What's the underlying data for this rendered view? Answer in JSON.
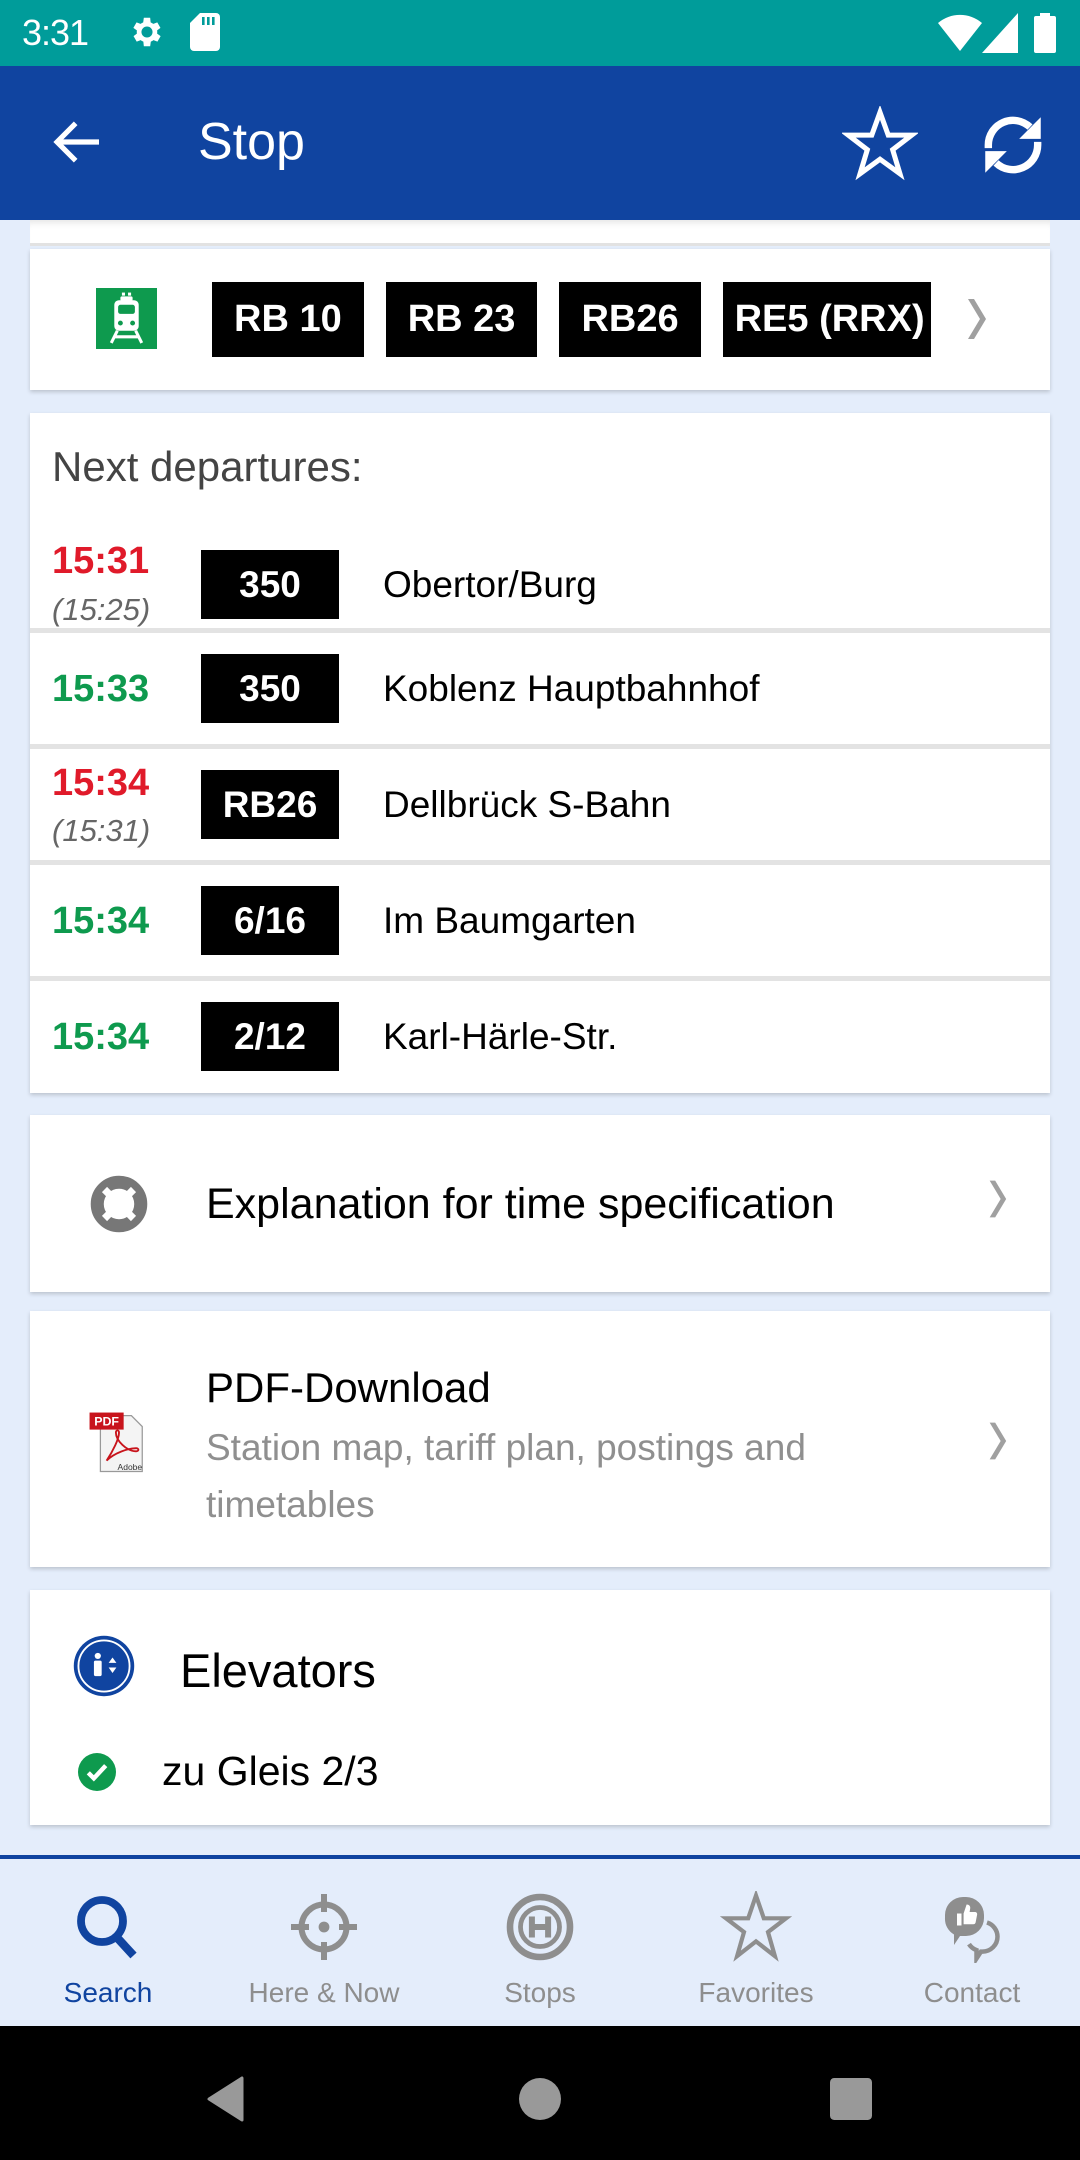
{
  "status_bar": {
    "time": "3:31",
    "icons": [
      "settings-icon",
      "sd-card-icon",
      "wifi-icon",
      "cell-signal-icon",
      "battery-icon"
    ]
  },
  "app_bar": {
    "title": "Stop",
    "actions": [
      "back-icon",
      "favorite-star-icon",
      "refresh-icon"
    ]
  },
  "lines": {
    "mode_icon": "train-icon",
    "badges": [
      "RB 10",
      "RB 23",
      "RB26",
      "RE5 (RRX)"
    ],
    "more_icon": "chevron-right-icon"
  },
  "departures": {
    "heading": "Next departures:",
    "rows": [
      {
        "time": "15:31",
        "planned": "(15:25)",
        "status": "late",
        "line": "350",
        "destination": "Obertor/Burg"
      },
      {
        "time": "15:33",
        "planned": "",
        "status": "ontime",
        "line": "350",
        "destination": "Koblenz Hauptbahnhof"
      },
      {
        "time": "15:34",
        "planned": "(15:31)",
        "status": "late",
        "line": "RB26",
        "destination": "Dellbrück S-Bahn"
      },
      {
        "time": "15:34",
        "planned": "",
        "status": "ontime",
        "line": "6/16",
        "destination": "Im Baumgarten"
      },
      {
        "time": "15:34",
        "planned": "",
        "status": "ontime",
        "line": "2/12",
        "destination": "Karl-Härle-Str."
      }
    ]
  },
  "explanation": {
    "icon": "lifebuoy-icon",
    "label": "Explanation for time specification"
  },
  "pdf": {
    "icon": "pdf-icon",
    "icon_text": "PDF",
    "icon_subtext": "Adobe",
    "title": "PDF-Download",
    "subtitle": "Station map, tariff plan, postings and timetables"
  },
  "elevators": {
    "icon": "elevator-icon",
    "title": "Elevators",
    "items": [
      {
        "label": "zu Gleis 2/3",
        "status": "ok"
      }
    ]
  },
  "bottom_nav": {
    "items": [
      {
        "label": "Search",
        "icon": "search-icon",
        "active": true
      },
      {
        "label": "Here & Now",
        "icon": "crosshair-icon",
        "active": false
      },
      {
        "label": "Stops",
        "icon": "stop-h-icon",
        "active": false
      },
      {
        "label": "Favorites",
        "icon": "star-icon",
        "active": false
      },
      {
        "label": "Contact",
        "icon": "contact-chat-icon",
        "active": false
      }
    ]
  },
  "colors": {
    "status_bar": "#009C9A",
    "app_bar": "#1044A0",
    "background": "#E4EDFB",
    "late": "#E01A2A",
    "on_time": "#0E9A4E",
    "train_green": "#0E9A4E",
    "inactive_gray": "#8E8E8E"
  }
}
